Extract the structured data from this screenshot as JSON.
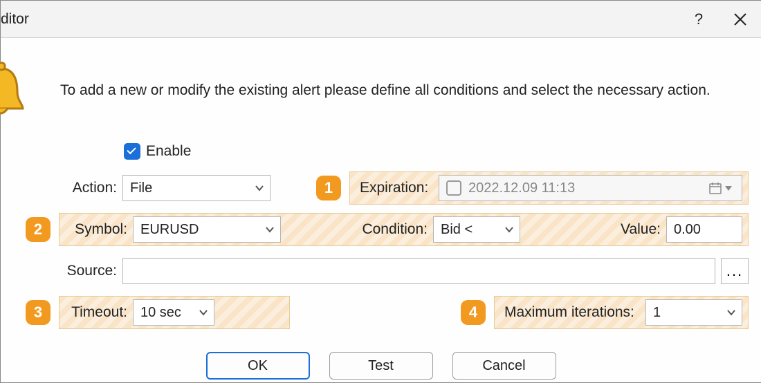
{
  "title": "ditor",
  "instruction": "To add a new or modify the existing alert please define all conditions and select the necessary action.",
  "enable_label": "Enable",
  "callouts": {
    "c1": "1",
    "c2": "2",
    "c3": "3",
    "c4": "4"
  },
  "labels": {
    "action": "Action:",
    "expiration": "Expiration:",
    "symbol": "Symbol:",
    "condition": "Condition:",
    "value": "Value:",
    "source": "Source:",
    "timeout": "Timeout:",
    "max_iter": "Maximum iterations:"
  },
  "values": {
    "action": "File",
    "expiration": "2022.12.09 11:13",
    "symbol": "EURUSD",
    "condition": "Bid <",
    "value": "0.00",
    "source": "",
    "timeout": "10 sec",
    "max_iter": "1"
  },
  "buttons": {
    "ok": "OK",
    "test": "Test",
    "cancel": "Cancel",
    "browse": "..."
  }
}
